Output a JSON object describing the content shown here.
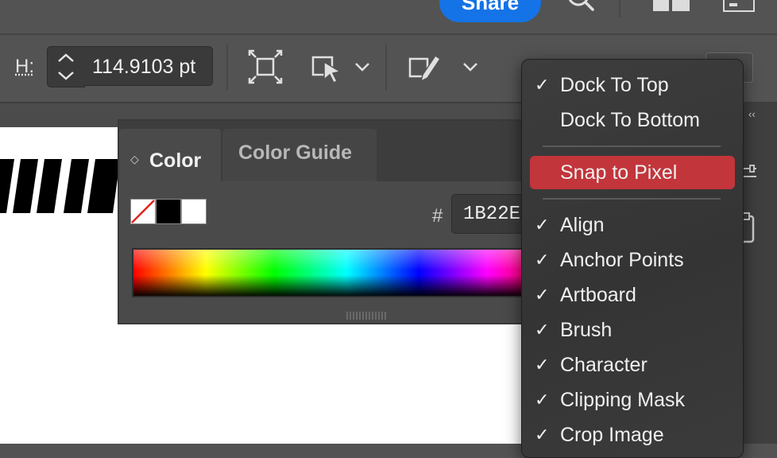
{
  "topbar": {
    "share_label": "Share"
  },
  "controlbar": {
    "h_label": "H:",
    "h_value": "114.9103 pt"
  },
  "color_panel": {
    "tabs": [
      {
        "label": "Color"
      },
      {
        "label": "Color Guide"
      }
    ],
    "hash_label": "#",
    "hex_value": "1B22E",
    "swatches": [
      "none",
      "#000000",
      "#ffffff"
    ]
  },
  "menu": {
    "items": [
      {
        "label": "Dock To Top",
        "checked": true
      },
      {
        "label": "Dock To Bottom",
        "checked": false
      },
      {
        "label": "Snap to Pixel",
        "checked": false,
        "highlighted": true
      },
      {
        "label": "Align",
        "checked": true
      },
      {
        "label": "Anchor Points",
        "checked": true
      },
      {
        "label": "Artboard",
        "checked": true
      },
      {
        "label": "Brush",
        "checked": true
      },
      {
        "label": "Character",
        "checked": true
      },
      {
        "label": "Clipping Mask",
        "checked": true
      },
      {
        "label": "Crop Image",
        "checked": true
      }
    ],
    "check_glyph": "✓"
  },
  "colors": {
    "accent": "#1473e6",
    "highlight": "#c2353b"
  }
}
